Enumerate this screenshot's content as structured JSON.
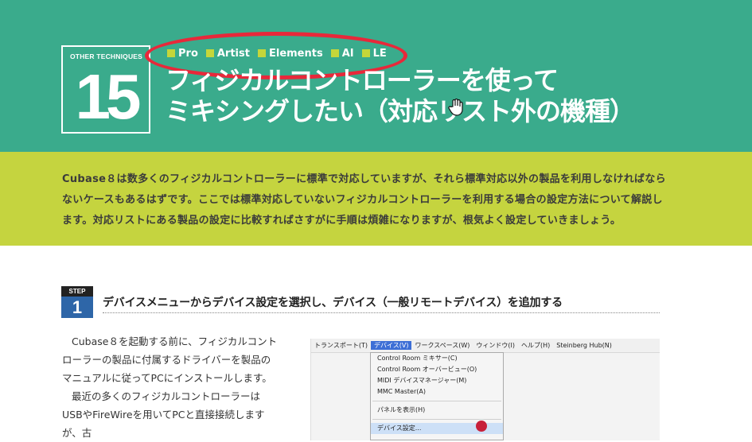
{
  "header": {
    "label": "OTHER TECHNIQUES",
    "number": "15",
    "tags": [
      "Pro",
      "Artist",
      "Elements",
      "AI",
      "LE"
    ],
    "title_line1": "フィジカルコントローラーを使って",
    "title_line2": "ミキシングしたい（対応リスト外の機種）"
  },
  "intro": {
    "text": "Cubase８は数多くのフィジカルコントローラーに標準で対応していますが、それら標準対応以外の製品を利用しなければならないケースもあるはずです。ここでは標準対応していないフィジカルコントローラーを利用する場合の設定方法について解説します。対応リストにある製品の設定に比較すればさすがに手順は煩雑になりますが、根気よく設定していきましょう。"
  },
  "step": {
    "label": "STEP",
    "number": "1",
    "title": "デバイスメニューからデバイス設定を選択し、デバイス（一般リモートデバイス）を追加する"
  },
  "body": {
    "para1": "Cubase８を起動する前に、フィジカルコントローラーの製品に付属するドライバーを製品のマニュアルに従ってPCにインストールします。",
    "para2": "最近の多くのフィジカルコントローラーはUSBやFireWireを用いてPCと直接接続しますが、古"
  },
  "screenshot": {
    "menubar": [
      "トランスポート(T)",
      "デバイス(V)",
      "ワークスペース(W)",
      "ウィンドウ(I)",
      "ヘルプ(H)",
      "Steinberg Hub(N)"
    ],
    "menu_items": [
      "Control Room ミキサー(C)",
      "Control Room オーバービュー(O)",
      "MIDI デバイスマネージャー(M)",
      "MMC Master(A)",
      "パネルを表示(H)",
      "デバイス設定..."
    ]
  },
  "colors": {
    "header_bg": "#3aab8c",
    "intro_bg": "#c5d43f",
    "tag_square": "#c5d63a",
    "highlight_ellipse": "#e8283a",
    "step_blue": "#2e66a8"
  }
}
